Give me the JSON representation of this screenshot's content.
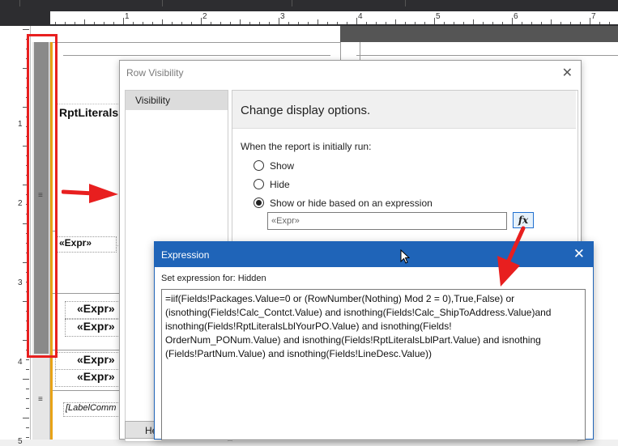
{
  "ruler": {
    "numbers": [
      "1",
      "2",
      "3",
      "4",
      "5",
      "6",
      "7"
    ],
    "vnumbers": [
      "1",
      "2",
      "3",
      "4",
      "5"
    ]
  },
  "report": {
    "cells": [
      "RptLiterals",
      "«Expr»",
      "«Expr»",
      "«Expr»",
      "«Expr»",
      "«Expr»",
      "[LabelComm"
    ]
  },
  "row_visibility": {
    "title": "Row Visibility",
    "nav_items": [
      "Visibility"
    ],
    "header": "Change display options.",
    "prompt": "When the report is initially run:",
    "options": [
      {
        "label": "Show",
        "selected": false
      },
      {
        "label": "Hide",
        "selected": false
      },
      {
        "label": "Show or hide based on an expression",
        "selected": true
      }
    ],
    "expression_placeholder": "«Expr»",
    "fx_label": "fx",
    "help_label": "He"
  },
  "expression_dialog": {
    "title": "Expression",
    "set_label": "Set expression for: Hidden",
    "expression": "=iif(Fields!Packages.Value=0 or (RowNumber(Nothing) Mod 2 = 0),True,False) or\n(isnothing(Fields!Calc_Contct.Value) and isnothing(Fields!Calc_ShipToAddress.Value)and\nisnothing(Fields!RptLiteralsLblYourPO.Value) and isnothing(Fields!\nOrderNum_PONum.Value) and isnothing(Fields!RptLiteralsLblPart.Value) and isnothing\n(Fields!PartNum.Value) and isnothing(Fields!LineDesc.Value))"
  },
  "colors": {
    "annotation_red": "#e81f1f",
    "title_blue": "#1f64b8",
    "row_gray": "#8a8a8a",
    "guide_orange": "#e8a317"
  }
}
